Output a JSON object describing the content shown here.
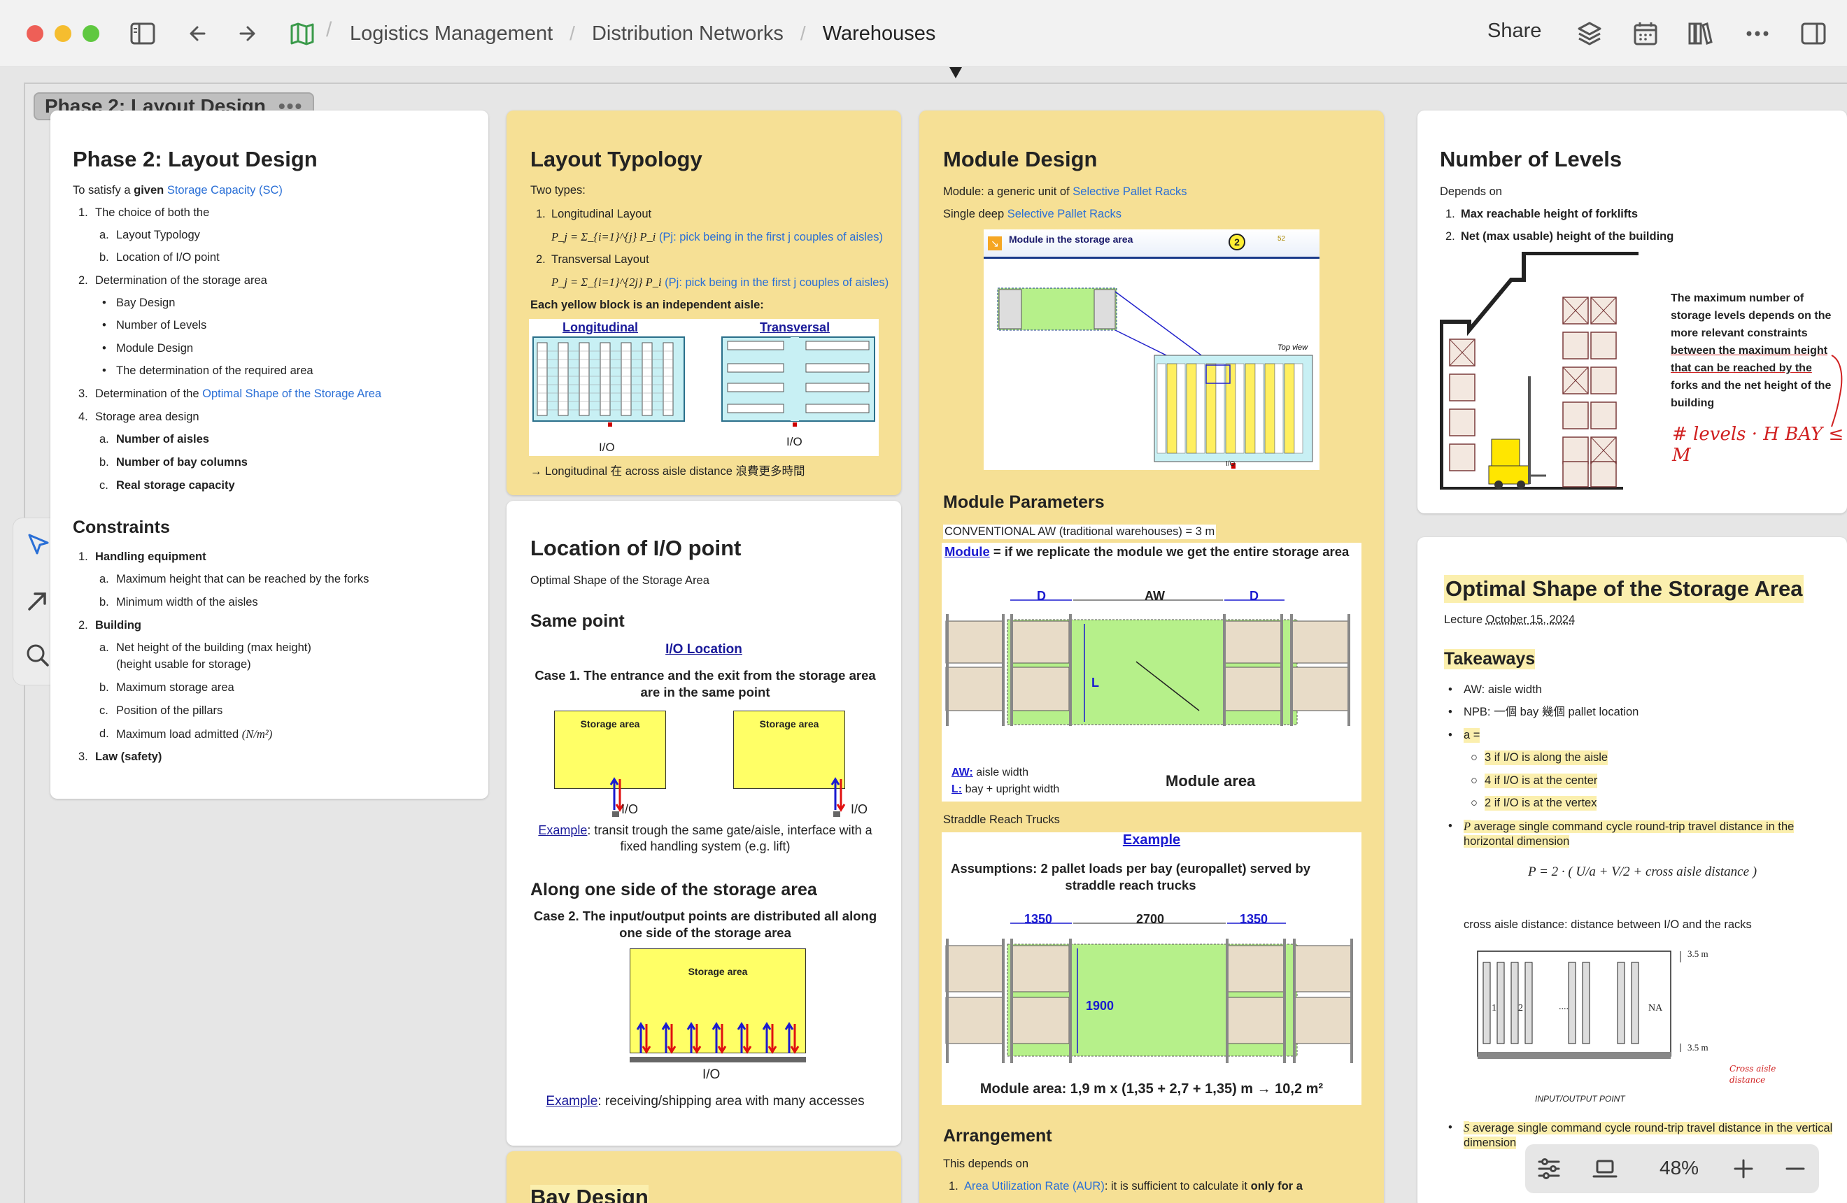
{
  "breadcrumb": {
    "items": [
      "Logistics Management",
      "Distribution Networks",
      "Warehouses"
    ]
  },
  "toolbar": {
    "share_label": "Share",
    "zoom": "48%"
  },
  "group": {
    "label": "Phase 2: Layout Design"
  },
  "phase2": {
    "title": "Phase 2: Layout Design",
    "intro_pre": "To satisfy a ",
    "intro_bold": "given ",
    "intro_link": "Storage Capacity (SC)",
    "i1": "The choice of both the",
    "i1a": "Layout Typology",
    "i1b": "Location of I/O point",
    "i2": "Determination of the storage area",
    "i2_b1": "Bay Design",
    "i2_b2": "Number of Levels",
    "i2_b3": "Module Design",
    "i2_b4": "The determination of the required area",
    "i3_pre": "Determination of the ",
    "i3_link": "Optimal Shape of the Storage Area",
    "i4": "Storage area design",
    "i4a": "Number of aisles",
    "i4b": "Number of bay columns",
    "i4c": "Real storage capacity",
    "constraints_title": "Constraints",
    "c1": "Handling equipment",
    "c1a": "Maximum height that can be reached by the forks",
    "c1b": "Minimum width of the aisles",
    "c2": "Building",
    "c2a": "Net height of the building (max height)",
    "c2a2": "(height usable for storage)",
    "c2b": "Maximum storage area",
    "c2c": "Position of the pillars",
    "c2d": "Maximum load admitted",
    "c2d_formula": "(N/m²)",
    "c3": "Law (safety)"
  },
  "layout_typology": {
    "title": "Layout Typology",
    "two_types": "Two types:",
    "t1": "Longitudinal Layout",
    "f1": "P_j = Σ_{i=1}^{j} P_i",
    "f1_note": "(Pj: pick being in the first j couples of aisles)",
    "t2": "Transversal Layout",
    "f2": "P_j = Σ_{i=1}^{2j} P_i",
    "f2_note": "(Pj: pick being in the first j couples of aisles)",
    "yellow_note": "Each yellow block is an independent aisle:",
    "img_longitudinal": "Longitudinal",
    "img_transversal": "Transversal",
    "io1": "I/O",
    "io2": "I/O",
    "arrow_note": "→ Longitudinal 在 across aisle distance 浪費更多時間"
  },
  "location_io": {
    "title": "Location of I/O point",
    "link": "Optimal Shape of the Storage Area",
    "same_point": "Same point",
    "img_title": "I/O Location",
    "case1": "Case 1. The entrance and the exit from the storage area are in the same point",
    "storage_area": "Storage area",
    "io": "I/O",
    "example1_link": "Example",
    "example1_text": ": transit trough the same gate/aisle, interface with a fixed handling system (e.g. lift)",
    "along": "Along one side of the storage area",
    "case2": "Case 2. The input/output points are distributed all along one side of the storage area",
    "example2_link": "Example",
    "example2_text": ": receiving/shipping area with many accesses"
  },
  "bay_design": {
    "title": "Bay Design"
  },
  "module_design": {
    "title": "Module Design",
    "l1_pre": "Module: a generic unit of ",
    "l1_link": "Selective Pallet Racks",
    "l2_pre": "Single deep ",
    "l2_link": "Selective Pallet Racks",
    "img1_title": "Module in the storage area",
    "img1_num": "2",
    "img1_topview": "Top view",
    "img1_io": "I/O",
    "img1_page": "52",
    "params_title": "Module Parameters",
    "conventional": "CONVENTIONAL AW (traditional warehouses) = 3 m",
    "module_link": "Module",
    "module_text": " = if we replicate the module we get the entire storage area",
    "dim_d1": "D",
    "dim_aw": "AW",
    "dim_d2": "D",
    "dim_l": "L",
    "legend_aw_key": "AW:",
    "legend_aw": "aisle width",
    "legend_l_key": "L:",
    "legend_l": "bay + upright width",
    "module_area": "Module area",
    "straddle_link": "Straddle Reach Trucks",
    "example_title": "Example",
    "assumptions": "Assumptions: 2 pallet loads per bay (europallet) served by straddle reach trucks",
    "ex_d1": "1350",
    "ex_aw": "2700",
    "ex_d2": "1350",
    "ex_l": "1900",
    "ex_area": "Module area: 1,9 m x (1,35 + 2,7 + 1,35) m → 10,2 m²",
    "arr_title": "Arrangement",
    "arr_depends": "This depends on",
    "arr1_link": "Area Utilization Rate (AUR)",
    "arr1_text": ": it is sufficient to calculate it ",
    "arr1_bold": "only for a"
  },
  "levels": {
    "title": "Number of Levels",
    "depends": "Depends on",
    "d1": "Max reachable height of forklifts",
    "d2": "Net (max usable) height of the building",
    "desc_1": "The maximum number of",
    "desc_2": "storage levels depends on the",
    "desc_3": "more relevant constraints",
    "desc_4": "between the maximum height",
    "desc_5": "that can be reached by the",
    "desc_6": "forks and the net height of the",
    "desc_7": "building",
    "hw_levels": "# levels · H BAY ≤ M"
  },
  "optimal": {
    "title": "Optimal Shape of the Storage Area",
    "lecture_pre": "Lecture ",
    "lecture_date": "October 15, 2024",
    "takeaways": "Takeaways",
    "b1": "AW: aisle width",
    "b2": "NPB: 一個 bay 幾個 pallet location",
    "b3": "a =",
    "b3a": "3 if I/O is along the aisle",
    "b3b": "4 if I/O is at the center",
    "b3c": "2 if I/O is at the vertex",
    "b4_sym": "P",
    "b4": " average single command cycle round-trip travel distance in the horizontal dimension",
    "formula": "P = 2 · ( U/a + V/2 + cross aisle distance )",
    "cross": "cross aisle distance: distance between I/O and the racks",
    "fig_35a": "3.5 m",
    "fig_35b": "3.5 m",
    "fig_1": "1",
    "fig_2": "2",
    "fig_dots": "....",
    "fig_na": "NA",
    "fig_io": "INPUT/OUTPUT POINT",
    "fig_hw": "Cross aisle distance",
    "b5_sym": "S",
    "b5": " average single command cycle round-trip travel distance in the vertical dimension"
  }
}
